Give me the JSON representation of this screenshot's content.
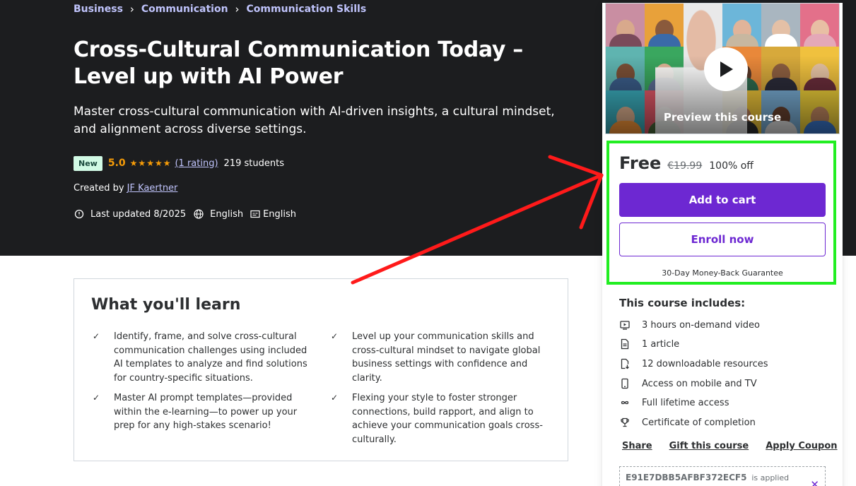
{
  "breadcrumb": [
    "Business",
    "Communication",
    "Communication Skills"
  ],
  "course": {
    "title": "Cross-Cultural Communication Today – Level up with AI Power",
    "subtitle": "Master cross-cultural communication with AI-driven insights, a cultural mindset, and alignment across diverse settings.",
    "badge": "New",
    "rating_value": "5.0",
    "stars": 5,
    "rating_count": "(1 rating)",
    "students": "219 students",
    "created_by_label": "Created by",
    "author": "JF Kaertner",
    "last_updated": "Last updated 8/2025",
    "language": "English",
    "captions": "English"
  },
  "learn": {
    "title": "What you'll learn",
    "items": [
      "Identify, frame, and solve cross-cultural communication challenges using included AI templates to analyze and find solutions for country-specific situations.",
      "Level up your communication skills and cross-cultural mindset to navigate global business settings with confidence and clarity.",
      "Master AI prompt templates—provided within the e-learning—to power up your prep for any high-stakes scenario!",
      "Flexing your style to foster stronger connections, build rapport, and align to achieve your communication goals cross-culturally."
    ]
  },
  "sidebar": {
    "preview_label": "Preview this course",
    "price_now": "Free",
    "price_old": "€19.99",
    "discount": "100% off",
    "add_to_cart": "Add to cart",
    "enroll_now": "Enroll now",
    "guarantee": "30-Day Money-Back Guarantee",
    "includes_title": "This course includes:",
    "includes": [
      {
        "icon": "video-icon",
        "text": "3 hours on-demand video"
      },
      {
        "icon": "article-icon",
        "text": "1 article"
      },
      {
        "icon": "download-icon",
        "text": "12 downloadable resources"
      },
      {
        "icon": "mobile-icon",
        "text": "Access on mobile and TV"
      },
      {
        "icon": "infinity-icon",
        "text": "Full lifetime access"
      },
      {
        "icon": "trophy-icon",
        "text": "Certificate of completion"
      }
    ],
    "links": [
      "Share",
      "Gift this course",
      "Apply Coupon"
    ],
    "coupon_code": "E91E7DBB5AFBF372ECF5",
    "coupon_applied": "is applied"
  },
  "colors": {
    "hero_bg": "#1c1d1f",
    "link_purple": "#c0c4fc",
    "primary_purple": "#6d28d2",
    "star_orange": "#f69c08",
    "badge_bg": "#d1fae5",
    "highlight_green": "#22ee22",
    "annotation_red": "#ff1a1a"
  }
}
